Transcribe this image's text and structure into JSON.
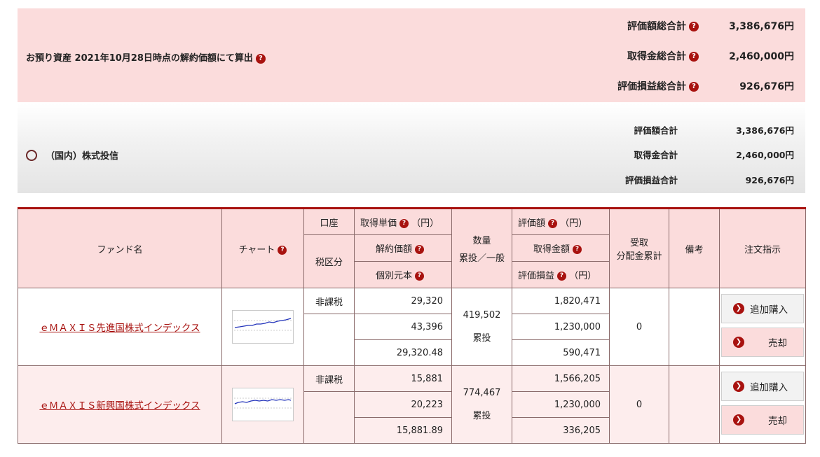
{
  "summary": {
    "asset_label": "お預り資産 2021年10月28日時点の解約価額にて算出",
    "rows": [
      {
        "label": "評価額総合計",
        "value": "3,386,676円"
      },
      {
        "label": "取得金総合計",
        "value": "2,460,000円"
      },
      {
        "label": "評価損益総合計",
        "value": "926,676円"
      }
    ]
  },
  "category": {
    "label": "（国内）株式投信",
    "rows": [
      {
        "label": "評価額合計",
        "value": "3,386,676円"
      },
      {
        "label": "取得金合計",
        "value": "2,460,000円"
      },
      {
        "label": "評価損益合計",
        "value": "926,676円"
      }
    ]
  },
  "table": {
    "headers": {
      "fund_name": "ファンド名",
      "chart": "チャート",
      "account": "口座",
      "tax": "税区分",
      "unit_cost": "取得単価",
      "unit_cost_unit": "（円）",
      "nav": "解約価額",
      "principal": "個別元本",
      "quantity": "数量",
      "quantity_sub": "累投／一般",
      "valuation": "評価額",
      "valuation_unit": "（円）",
      "cost_amount": "取得金額",
      "pnl": "評価損益",
      "pnl_unit": "（円）",
      "dividend_line1": "受取",
      "dividend_line2": "分配金累計",
      "remarks": "備考",
      "order": "注文指示"
    },
    "rows": [
      {
        "fund_name": "ｅＭＡＸＩＳ先進国株式インデックス",
        "tax_type": "非課税",
        "unit_cost": "29,320",
        "nav": "43,396",
        "principal": "29,320.48",
        "quantity": "419,502",
        "quantity_type": "累投",
        "valuation": "1,820,471",
        "cost_amount": "1,230,000",
        "pnl": "590,471",
        "dividend": "0",
        "buy_label": "追加購入",
        "sell_label": "売却"
      },
      {
        "fund_name": "ｅＭＡＸＩＳ新興国株式インデックス",
        "tax_type": "非課税",
        "unit_cost": "15,881",
        "nav": "20,223",
        "principal": "15,881.89",
        "quantity": "774,467",
        "quantity_type": "累投",
        "valuation": "1,566,205",
        "cost_amount": "1,230,000",
        "pnl": "336,205",
        "dividend": "0",
        "buy_label": "追加購入",
        "sell_label": "売却"
      }
    ]
  },
  "icons": {
    "help": "question-circle-icon",
    "arrow": "arrow-right-circle-icon"
  },
  "colors": {
    "accent": "#a8120f",
    "pink_bg": "#fbdcdc",
    "row_pink": "#fdeded"
  }
}
